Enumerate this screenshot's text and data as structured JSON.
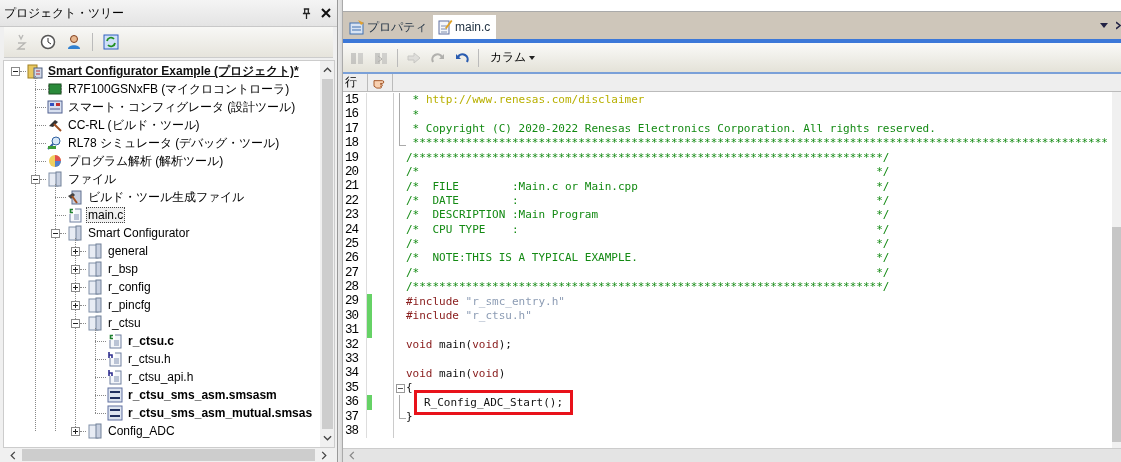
{
  "project_tree": {
    "title": "プロジェクト・ツリー",
    "toolbar": [
      {
        "kind": "sort",
        "disabled": true
      },
      {
        "kind": "history",
        "disabled": false
      },
      {
        "kind": "user",
        "disabled": false
      },
      {
        "kind": "separator"
      },
      {
        "kind": "refresh",
        "disabled": false
      }
    ],
    "items": [
      {
        "label": "Smart Configurator Example (プロジェクト)*",
        "kind": "project",
        "active": true,
        "expanded": true,
        "selected": false,
        "children": [
          {
            "label": "R7F100GSNxFB (マイクロコントローラ)",
            "kind": "microcontroller",
            "selected": false
          },
          {
            "label": "スマート・コンフィグレータ (設計ツール)",
            "kind": "design-tool",
            "selected": false
          },
          {
            "label": "CC-RL (ビルド・ツール)",
            "kind": "build-tool",
            "selected": false
          },
          {
            "label": "RL78 シミュレータ (デバッグ・ツール)",
            "kind": "debug-tool",
            "selected": false
          },
          {
            "label": "プログラム解析 (解析ツール)",
            "kind": "analysis-tool",
            "selected": false
          },
          {
            "label": "ファイル",
            "kind": "category",
            "expanded": true,
            "selected": false,
            "children": [
              {
                "label": "ビルド・ツール生成ファイル",
                "kind": "build-files",
                "selected": false
              },
              {
                "label": "main.c",
                "kind": "c-file",
                "selected": true
              },
              {
                "label": "Smart Configurator",
                "kind": "category",
                "expanded": true,
                "selected": false,
                "children": [
                  {
                    "label": "general",
                    "kind": "category",
                    "expanded": false,
                    "selected": false
                  },
                  {
                    "label": "r_bsp",
                    "kind": "category",
                    "expanded": false,
                    "selected": false
                  },
                  {
                    "label": "r_config",
                    "kind": "category",
                    "expanded": false,
                    "selected": false
                  },
                  {
                    "label": "r_pincfg",
                    "kind": "category",
                    "expanded": false,
                    "selected": false
                  },
                  {
                    "label": "r_ctsu",
                    "kind": "category",
                    "expanded": true,
                    "selected": false,
                    "children": [
                      {
                        "label": "r_ctsu.c",
                        "kind": "c-file",
                        "bold": true,
                        "selected": false
                      },
                      {
                        "label": "r_ctsu.h",
                        "kind": "h-file",
                        "bold": false,
                        "selected": false
                      },
                      {
                        "label": "r_ctsu_api.h",
                        "kind": "h-file",
                        "bold": false,
                        "selected": false
                      },
                      {
                        "label": "r_ctsu_sms_asm.smsasm",
                        "kind": "asm-file",
                        "bold": true,
                        "selected": false
                      },
                      {
                        "label": "r_ctsu_sms_asm_mutual.smsas",
                        "kind": "asm-file",
                        "bold": true,
                        "selected": false
                      }
                    ]
                  },
                  {
                    "label": "Config_ADC",
                    "kind": "category",
                    "expanded": false,
                    "selected": false
                  }
                ]
              }
            ]
          }
        ]
      }
    ]
  },
  "editor": {
    "tabs": [
      {
        "label": "プロパティ",
        "kind": "properties",
        "selected": false
      },
      {
        "label": "main.c",
        "kind": "file",
        "selected": true
      }
    ],
    "toolbar": [
      {
        "kind": "bookmark",
        "disabled": true
      },
      {
        "kind": "bookmark-next",
        "disabled": true
      },
      {
        "kind": "separator"
      },
      {
        "kind": "jump",
        "disabled": true
      },
      {
        "kind": "redo",
        "disabled": true
      },
      {
        "kind": "undo",
        "disabled": false
      },
      {
        "kind": "separator"
      },
      {
        "kind": "menu",
        "label": "カラム"
      }
    ],
    "gutter_header": "行",
    "lines": [
      {
        "number": "15",
        "modified": false,
        "highlighted": false,
        "kind": "fold-body",
        "tokens": [
          {
            "kind": "comment",
            "text": " * "
          },
          {
            "kind": "link",
            "text": "http://www.renesas.com/disclaimer"
          }
        ]
      },
      {
        "number": "16",
        "modified": false,
        "highlighted": false,
        "kind": "fold-body",
        "tokens": [
          {
            "kind": "comment",
            "text": " *"
          }
        ]
      },
      {
        "number": "17",
        "modified": false,
        "highlighted": false,
        "kind": "fold-body",
        "tokens": [
          {
            "kind": "comment",
            "text": " * Copyright (C) 2020-2022 Renesas Electronics Corporation. All rights reserved."
          }
        ]
      },
      {
        "number": "18",
        "modified": false,
        "highlighted": false,
        "kind": "fold-end",
        "tokens": [
          {
            "kind": "comment",
            "text": " *********************************************************************************************************"
          }
        ]
      },
      {
        "number": "19",
        "modified": false,
        "highlighted": false,
        "tokens": [
          {
            "kind": "comment",
            "text": "/***********************************************************************/"
          }
        ]
      },
      {
        "number": "20",
        "modified": false,
        "highlighted": false,
        "box_end": "*/",
        "tokens": [
          {
            "kind": "comment",
            "text": "/*"
          }
        ]
      },
      {
        "number": "21",
        "modified": false,
        "highlighted": false,
        "box_end": "*/",
        "tokens": [
          {
            "kind": "comment",
            "text": "/*  FILE        :Main.c or Main.cpp"
          }
        ]
      },
      {
        "number": "22",
        "modified": false,
        "highlighted": false,
        "box_end": "*/",
        "tokens": [
          {
            "kind": "comment",
            "text": "/*  DATE        :"
          }
        ]
      },
      {
        "number": "23",
        "modified": false,
        "highlighted": false,
        "box_end": "*/",
        "tokens": [
          {
            "kind": "comment",
            "text": "/*  DESCRIPTION :Main Program"
          }
        ]
      },
      {
        "number": "24",
        "modified": false,
        "highlighted": false,
        "box_end": "*/",
        "tokens": [
          {
            "kind": "comment",
            "text": "/*  CPU TYPE    :"
          }
        ]
      },
      {
        "number": "25",
        "modified": false,
        "highlighted": false,
        "box_end": "*/",
        "tokens": [
          {
            "kind": "comment",
            "text": "/*"
          }
        ]
      },
      {
        "number": "26",
        "modified": false,
        "highlighted": false,
        "box_end": "*/",
        "tokens": [
          {
            "kind": "comment",
            "text": "/*  NOTE:THIS IS A TYPICAL EXAMPLE."
          }
        ]
      },
      {
        "number": "27",
        "modified": false,
        "highlighted": false,
        "box_end": "*/",
        "tokens": [
          {
            "kind": "comment",
            "text": "/*"
          }
        ]
      },
      {
        "number": "28",
        "modified": false,
        "highlighted": false,
        "tokens": [
          {
            "kind": "comment",
            "text": "/***********************************************************************/"
          }
        ]
      },
      {
        "number": "29",
        "modified": true,
        "highlighted": false,
        "tokens": [
          {
            "kind": "keyword",
            "text": "#include"
          },
          {
            "kind": "string",
            "text": " \"r_smc_entry.h\""
          }
        ]
      },
      {
        "number": "30",
        "modified": true,
        "highlighted": false,
        "tokens": [
          {
            "kind": "keyword",
            "text": "#include"
          },
          {
            "kind": "string",
            "text": " \"r_ctsu.h\""
          }
        ]
      },
      {
        "number": "31",
        "modified": true,
        "highlighted": false
      },
      {
        "number": "32",
        "modified": false,
        "highlighted": false,
        "tokens": [
          {
            "kind": "keyword",
            "text": "void"
          },
          {
            "kind": "plain",
            "text": " main("
          },
          {
            "kind": "keyword",
            "text": "void"
          },
          {
            "kind": "plain",
            "text": ");"
          }
        ]
      },
      {
        "number": "33",
        "modified": false,
        "highlighted": false
      },
      {
        "number": "34",
        "modified": false,
        "highlighted": false,
        "tokens": [
          {
            "kind": "keyword",
            "text": "void"
          },
          {
            "kind": "plain",
            "text": " main("
          },
          {
            "kind": "keyword",
            "text": "void"
          },
          {
            "kind": "plain",
            "text": ")"
          }
        ]
      },
      {
        "number": "35",
        "modified": false,
        "highlighted": false,
        "kind": "fold-start",
        "expanded": true,
        "tokens": [
          {
            "kind": "plain",
            "text": "{"
          }
        ]
      },
      {
        "number": "36",
        "modified": true,
        "highlighted": true,
        "kind": "fold-body",
        "tokens": [
          {
            "kind": "plain",
            "text": "R_Config_ADC_Start();"
          }
        ]
      },
      {
        "number": "37",
        "modified": false,
        "highlighted": false,
        "kind": "fold-end",
        "tokens": [
          {
            "kind": "plain",
            "text": "}"
          }
        ]
      },
      {
        "number": "38",
        "modified": false,
        "highlighted": false
      }
    ]
  }
}
